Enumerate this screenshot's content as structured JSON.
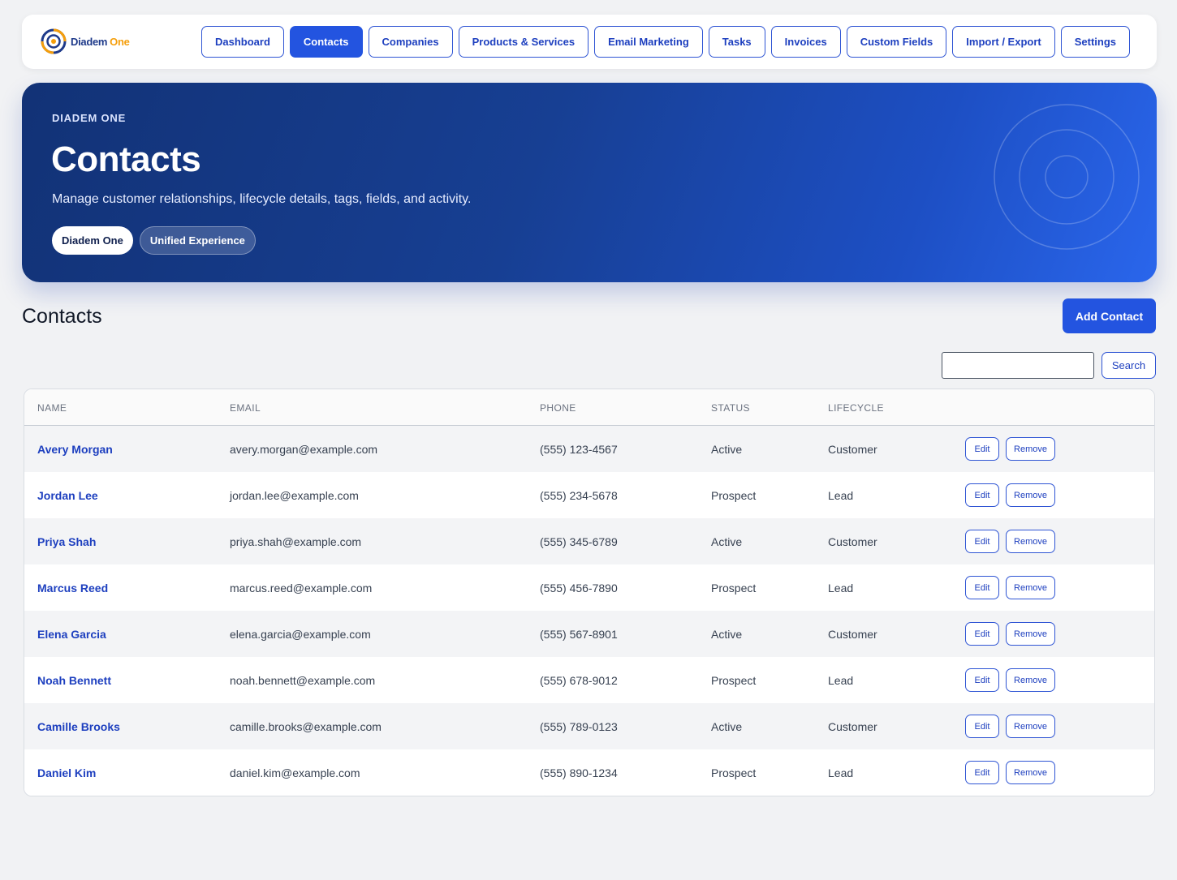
{
  "brand": {
    "name_primary": "Diadem",
    "name_accent": "One",
    "logo_icon": "diadem-logo-icon"
  },
  "nav": {
    "items": [
      {
        "label": "Dashboard",
        "active": false
      },
      {
        "label": "Contacts",
        "active": true
      },
      {
        "label": "Companies",
        "active": false
      },
      {
        "label": "Products & Services",
        "active": false
      },
      {
        "label": "Email Marketing",
        "active": false
      },
      {
        "label": "Tasks",
        "active": false
      },
      {
        "label": "Invoices",
        "active": false
      },
      {
        "label": "Custom Fields",
        "active": false
      },
      {
        "label": "Import / Export",
        "active": false
      },
      {
        "label": "Settings",
        "active": false
      }
    ]
  },
  "hero": {
    "eyebrow": "DIADEM ONE",
    "title": "Contacts",
    "subtitle": "Manage customer relationships, lifecycle details, tags, fields, and activity.",
    "pill_primary": "Diadem One",
    "pill_secondary": "Unified Experience"
  },
  "section": {
    "title": "Contacts",
    "add_label": "Add Contact",
    "search_value": "",
    "search_label": "Search"
  },
  "table": {
    "headers": {
      "name": "NAME",
      "email": "EMAIL",
      "phone": "PHONE",
      "status": "STATUS",
      "lifecycle": "LIFECYCLE"
    },
    "edit_label": "Edit",
    "remove_label": "Remove",
    "rows": [
      {
        "name": "Avery Morgan",
        "email": "avery.morgan@example.com",
        "phone": "(555) 123-4567",
        "status": "Active",
        "lifecycle": "Customer"
      },
      {
        "name": "Jordan Lee",
        "email": "jordan.lee@example.com",
        "phone": "(555) 234-5678",
        "status": "Prospect",
        "lifecycle": "Lead"
      },
      {
        "name": "Priya Shah",
        "email": "priya.shah@example.com",
        "phone": "(555) 345-6789",
        "status": "Active",
        "lifecycle": "Customer"
      },
      {
        "name": "Marcus Reed",
        "email": "marcus.reed@example.com",
        "phone": "(555) 456-7890",
        "status": "Prospect",
        "lifecycle": "Lead"
      },
      {
        "name": "Elena Garcia",
        "email": "elena.garcia@example.com",
        "phone": "(555) 567-8901",
        "status": "Active",
        "lifecycle": "Customer"
      },
      {
        "name": "Noah Bennett",
        "email": "noah.bennett@example.com",
        "phone": "(555) 678-9012",
        "status": "Prospect",
        "lifecycle": "Lead"
      },
      {
        "name": "Camille Brooks",
        "email": "camille.brooks@example.com",
        "phone": "(555) 789-0123",
        "status": "Active",
        "lifecycle": "Customer"
      },
      {
        "name": "Daniel Kim",
        "email": "daniel.kim@example.com",
        "phone": "(555) 890-1234",
        "status": "Prospect",
        "lifecycle": "Lead"
      }
    ]
  },
  "colors": {
    "accent": "#2354e0",
    "hero_start": "#123276",
    "hero_end": "#2a66ec",
    "brand_accent": "#f59e0b"
  }
}
